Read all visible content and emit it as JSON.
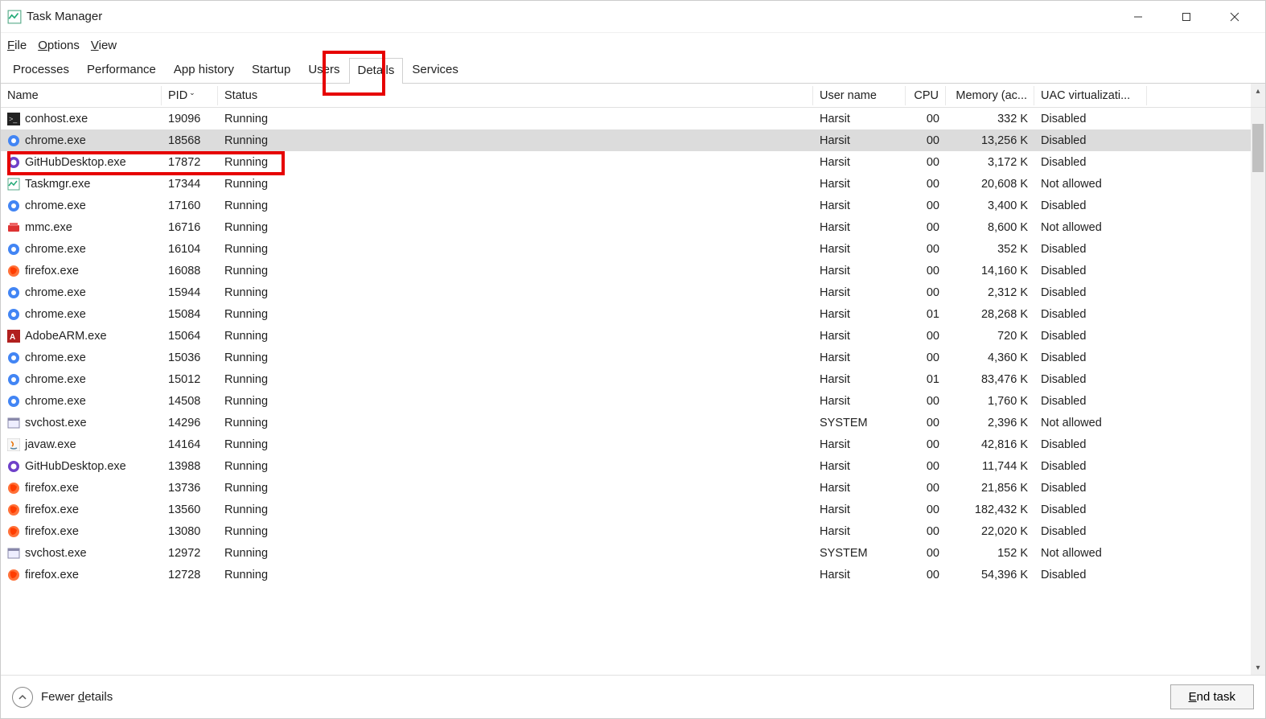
{
  "window": {
    "title": "Task Manager"
  },
  "menu": {
    "file": "File",
    "options": "Options",
    "view": "View"
  },
  "tabs": [
    "Processes",
    "Performance",
    "App history",
    "Startup",
    "Users",
    "Details",
    "Services"
  ],
  "active_tab": "Details",
  "columns": {
    "name": "Name",
    "pid": "PID",
    "status": "Status",
    "user": "User name",
    "cpu": "CPU",
    "mem": "Memory (ac...",
    "uac": "UAC virtualizati..."
  },
  "footer": {
    "fewer": "Fewer details",
    "endtask": "End task"
  },
  "processes": [
    {
      "icon": "console",
      "name": "conhost.exe",
      "pid": "19096",
      "status": "Running",
      "user": "Harsit",
      "cpu": "00",
      "mem": "332 K",
      "uac": "Disabled"
    },
    {
      "icon": "chrome",
      "name": "chrome.exe",
      "pid": "18568",
      "status": "Running",
      "user": "Harsit",
      "cpu": "00",
      "mem": "13,256 K",
      "uac": "Disabled",
      "selected": true
    },
    {
      "icon": "github",
      "name": "GitHubDesktop.exe",
      "pid": "17872",
      "status": "Running",
      "user": "Harsit",
      "cpu": "00",
      "mem": "3,172 K",
      "uac": "Disabled"
    },
    {
      "icon": "taskmgr",
      "name": "Taskmgr.exe",
      "pid": "17344",
      "status": "Running",
      "user": "Harsit",
      "cpu": "00",
      "mem": "20,608 K",
      "uac": "Not allowed"
    },
    {
      "icon": "chrome",
      "name": "chrome.exe",
      "pid": "17160",
      "status": "Running",
      "user": "Harsit",
      "cpu": "00",
      "mem": "3,400 K",
      "uac": "Disabled"
    },
    {
      "icon": "mmc",
      "name": "mmc.exe",
      "pid": "16716",
      "status": "Running",
      "user": "Harsit",
      "cpu": "00",
      "mem": "8,600 K",
      "uac": "Not allowed"
    },
    {
      "icon": "chrome",
      "name": "chrome.exe",
      "pid": "16104",
      "status": "Running",
      "user": "Harsit",
      "cpu": "00",
      "mem": "352 K",
      "uac": "Disabled"
    },
    {
      "icon": "firefox",
      "name": "firefox.exe",
      "pid": "16088",
      "status": "Running",
      "user": "Harsit",
      "cpu": "00",
      "mem": "14,160 K",
      "uac": "Disabled"
    },
    {
      "icon": "chrome",
      "name": "chrome.exe",
      "pid": "15944",
      "status": "Running",
      "user": "Harsit",
      "cpu": "00",
      "mem": "2,312 K",
      "uac": "Disabled"
    },
    {
      "icon": "chrome",
      "name": "chrome.exe",
      "pid": "15084",
      "status": "Running",
      "user": "Harsit",
      "cpu": "01",
      "mem": "28,268 K",
      "uac": "Disabled"
    },
    {
      "icon": "adobe",
      "name": "AdobeARM.exe",
      "pid": "15064",
      "status": "Running",
      "user": "Harsit",
      "cpu": "00",
      "mem": "720 K",
      "uac": "Disabled"
    },
    {
      "icon": "chrome",
      "name": "chrome.exe",
      "pid": "15036",
      "status": "Running",
      "user": "Harsit",
      "cpu": "00",
      "mem": "4,360 K",
      "uac": "Disabled"
    },
    {
      "icon": "chrome",
      "name": "chrome.exe",
      "pid": "15012",
      "status": "Running",
      "user": "Harsit",
      "cpu": "01",
      "mem": "83,476 K",
      "uac": "Disabled"
    },
    {
      "icon": "chrome",
      "name": "chrome.exe",
      "pid": "14508",
      "status": "Running",
      "user": "Harsit",
      "cpu": "00",
      "mem": "1,760 K",
      "uac": "Disabled"
    },
    {
      "icon": "svchost",
      "name": "svchost.exe",
      "pid": "14296",
      "status": "Running",
      "user": "SYSTEM",
      "cpu": "00",
      "mem": "2,396 K",
      "uac": "Not allowed"
    },
    {
      "icon": "java",
      "name": "javaw.exe",
      "pid": "14164",
      "status": "Running",
      "user": "Harsit",
      "cpu": "00",
      "mem": "42,816 K",
      "uac": "Disabled"
    },
    {
      "icon": "github",
      "name": "GitHubDesktop.exe",
      "pid": "13988",
      "status": "Running",
      "user": "Harsit",
      "cpu": "00",
      "mem": "11,744 K",
      "uac": "Disabled"
    },
    {
      "icon": "firefox",
      "name": "firefox.exe",
      "pid": "13736",
      "status": "Running",
      "user": "Harsit",
      "cpu": "00",
      "mem": "21,856 K",
      "uac": "Disabled"
    },
    {
      "icon": "firefox",
      "name": "firefox.exe",
      "pid": "13560",
      "status": "Running",
      "user": "Harsit",
      "cpu": "00",
      "mem": "182,432 K",
      "uac": "Disabled"
    },
    {
      "icon": "firefox",
      "name": "firefox.exe",
      "pid": "13080",
      "status": "Running",
      "user": "Harsit",
      "cpu": "00",
      "mem": "22,020 K",
      "uac": "Disabled"
    },
    {
      "icon": "svchost",
      "name": "svchost.exe",
      "pid": "12972",
      "status": "Running",
      "user": "SYSTEM",
      "cpu": "00",
      "mem": "152 K",
      "uac": "Not allowed"
    },
    {
      "icon": "firefox",
      "name": "firefox.exe",
      "pid": "12728",
      "status": "Running",
      "user": "Harsit",
      "cpu": "00",
      "mem": "54,396 K",
      "uac": "Disabled"
    }
  ]
}
